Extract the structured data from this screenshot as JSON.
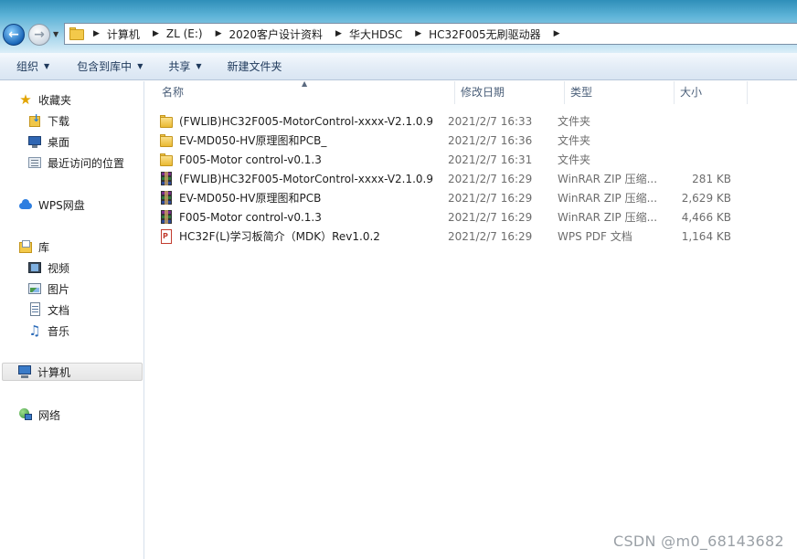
{
  "breadcrumb": {
    "segments": [
      "计算机",
      "ZL (E:)",
      "2020客户设计资料",
      "华大HDSC",
      "HC32F005无刷驱动器"
    ]
  },
  "toolbar": {
    "organize": "组织",
    "include_in_library": "包含到库中",
    "share": "共享",
    "new_folder": "新建文件夹"
  },
  "sidebar": {
    "favorites": "收藏夹",
    "downloads": "下载",
    "desktop": "桌面",
    "recent": "最近访问的位置",
    "wps_drive": "WPS网盘",
    "libraries": "库",
    "videos": "视频",
    "pictures": "图片",
    "documents": "文档",
    "music": "音乐",
    "computer": "计算机",
    "network": "网络"
  },
  "columns": {
    "name": "名称",
    "date": "修改日期",
    "type": "类型",
    "size": "大小"
  },
  "files": [
    {
      "name": "(FWLIB)HC32F005-MotorControl-xxxx-V2.1.0.9",
      "date": "2021/2/7 16:33",
      "type": "文件夹",
      "size": "",
      "icon": "folder-icon"
    },
    {
      "name": "EV-MD050-HV原理图和PCB_",
      "date": "2021/2/7 16:36",
      "type": "文件夹",
      "size": "",
      "icon": "folder-icon"
    },
    {
      "name": "F005-Motor control-v0.1.3",
      "date": "2021/2/7 16:31",
      "type": "文件夹",
      "size": "",
      "icon": "folder-icon"
    },
    {
      "name": "(FWLIB)HC32F005-MotorControl-xxxx-V2.1.0.9",
      "date": "2021/2/7 16:29",
      "type": "WinRAR ZIP 压缩...",
      "size": "281 KB",
      "icon": "rar-archive-icon"
    },
    {
      "name": "EV-MD050-HV原理图和PCB",
      "date": "2021/2/7 16:29",
      "type": "WinRAR ZIP 压缩...",
      "size": "2,629 KB",
      "icon": "rar-archive-icon"
    },
    {
      "name": "F005-Motor control-v0.1.3",
      "date": "2021/2/7 16:29",
      "type": "WinRAR ZIP 压缩...",
      "size": "4,466 KB",
      "icon": "rar-archive-icon"
    },
    {
      "name": "HC32F(L)学习板简介（MDK）Rev1.0.2",
      "date": "2021/2/7 16:29",
      "type": "WPS PDF 文档",
      "size": "1,164 KB",
      "icon": "pdf-icon"
    }
  ],
  "watermark": "CSDN @m0_68143682"
}
